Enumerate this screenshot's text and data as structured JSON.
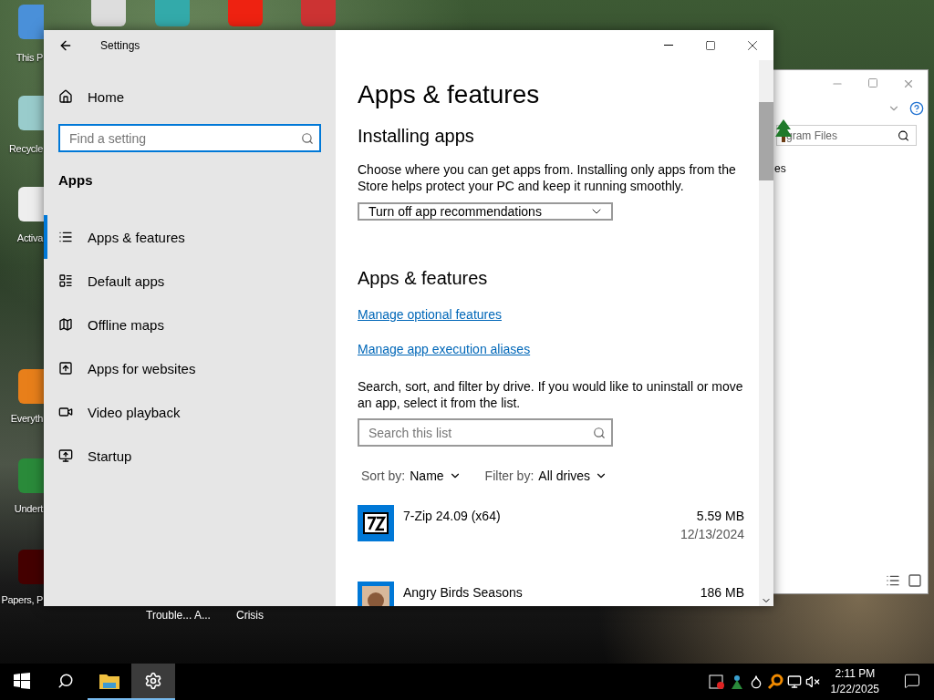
{
  "desktop": {
    "icons": [
      {
        "label": "This P"
      },
      {
        "label": "Recycle"
      },
      {
        "label": "Activa"
      },
      {
        "label": "Everyth"
      },
      {
        "label": "Undert"
      },
      {
        "label": "Papers, P"
      }
    ],
    "bottom_labels": [
      "Trouble... A...",
      "Crisis"
    ]
  },
  "explorer_window": {
    "search_value": "gram Files",
    "list_text": "es"
  },
  "settings": {
    "title": "Settings",
    "home": "Home",
    "search": {
      "placeholder": "Find a setting"
    },
    "section": "Apps",
    "nav": [
      {
        "label": "Apps & features",
        "kind": "list",
        "selected": true
      },
      {
        "label": "Default apps",
        "kind": "defaults",
        "selected": false
      },
      {
        "label": "Offline maps",
        "kind": "map",
        "selected": false
      },
      {
        "label": "Apps for websites",
        "kind": "web",
        "selected": false
      },
      {
        "label": "Video playback",
        "kind": "video",
        "selected": false
      },
      {
        "label": "Startup",
        "kind": "startup",
        "selected": false
      }
    ],
    "page_title": "Apps & features",
    "installing_heading": "Installing apps",
    "installing_text": "Choose where you can get apps from. Installing only apps from the Store helps protect your PC and keep it running smoothly.",
    "recommendation_select": "Turn off app recommendations",
    "features_heading": "Apps & features",
    "links": [
      "Manage optional features",
      "Manage app execution aliases"
    ],
    "list_text": "Search, sort, and filter by drive. If you would like to uninstall or move an app, select it from the list.",
    "list_search": {
      "placeholder": "Search this list"
    },
    "sort": {
      "label": "Sort by:",
      "value": "Name"
    },
    "filter": {
      "label": "Filter by:",
      "value": "All drives"
    },
    "apps": [
      {
        "name": "7-Zip 24.09 (x64)",
        "kind": "zip",
        "size": "5.59 MB",
        "date": "12/13/2024"
      },
      {
        "name": "Angry Birds Seasons",
        "kind": "game",
        "size": "186 MB"
      }
    ]
  },
  "taskbar": {
    "apps": [
      {
        "kind": "explorer",
        "selected": false
      },
      {
        "kind": "settings",
        "selected": true
      }
    ],
    "time": "2:11 PM",
    "date": "1/22/2025"
  }
}
